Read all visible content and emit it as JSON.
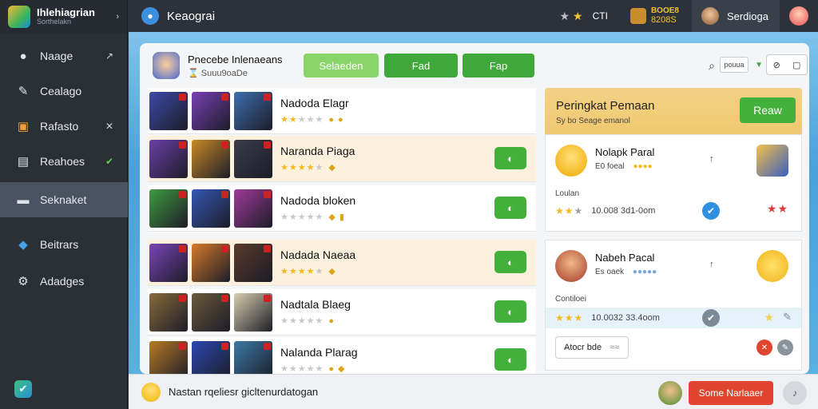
{
  "app": {
    "name": "Ihlehiagrian",
    "subtitle": "Sorthelakn",
    "chevron": "›",
    "bottom_icon": "shield-check-icon"
  },
  "sidebar": {
    "items": [
      {
        "label": "Naage",
        "icon": "pin-icon",
        "glyph": "●",
        "mark": "↗",
        "mark_green": false,
        "active": false
      },
      {
        "label": "Cealago",
        "icon": "wrench-icon",
        "glyph": "✎",
        "mark": "",
        "mark_green": false,
        "active": false
      },
      {
        "label": "Rafasto",
        "icon": "card-icon",
        "glyph": "▣",
        "mark": "✕",
        "mark_green": false,
        "active": false
      },
      {
        "label": "Reahoes",
        "icon": "list-icon",
        "glyph": "▤",
        "mark": "✔",
        "mark_green": true,
        "active": false
      },
      {
        "label": "Seknaket",
        "icon": "folder-icon",
        "glyph": "▬",
        "mark": "",
        "mark_green": false,
        "active": true
      },
      {
        "label": "Beitrars",
        "icon": "people-icon",
        "glyph": "◆",
        "mark": "",
        "mark_green": false,
        "active": false
      },
      {
        "label": "Adadges",
        "icon": "gear-icon",
        "glyph": "⚙",
        "mark": "",
        "mark_green": false,
        "active": false
      }
    ]
  },
  "topbar": {
    "title": "Keaograi",
    "app_icon": "app-icon",
    "level_label": "CTI",
    "coins_top": "BOOE8",
    "coins_bottom": "8208S",
    "user_name": "Serdioga"
  },
  "panel": {
    "title": "Pnecebe Inlenaeans",
    "subtitle": "Suuu9oaDe",
    "subtitle_prefix": "⌛",
    "tabs": [
      "Selaeden",
      "Fad",
      "Fap"
    ],
    "select_value": "pouua",
    "ctrl_left": "⊘",
    "ctrl_right": "▢"
  },
  "list": {
    "rows": [
      {
        "name": "Nadoda Elagr",
        "rating": 2,
        "extra": "● ●",
        "has_button": false,
        "alt": false,
        "tiles": [
          "#3a4aa8",
          "#7a3fb5",
          "#3d6fb0"
        ]
      },
      {
        "name": "Naranda Piaga",
        "rating": 4,
        "extra": "◆",
        "has_button": true,
        "alt": true,
        "tiles": [
          "#6a3fa8",
          "#c98a26",
          "#3b3b4a"
        ]
      },
      {
        "name": "Nadoda bloken",
        "rating": 0,
        "extra": "◆ ▮",
        "has_button": true,
        "alt": false,
        "tiles": [
          "#3f9a3f",
          "#3457b5",
          "#a03a9a"
        ]
      },
      {
        "name": "Nadada Naeaa",
        "rating": 4,
        "extra": "◆",
        "has_button": true,
        "alt": true,
        "tiles": [
          "#7a44b8",
          "#d67a2a",
          "#5a3a2a"
        ]
      },
      {
        "name": "Nadtala Blaeg",
        "rating": 0,
        "extra": "●",
        "has_button": true,
        "alt": false,
        "tiles": [
          "#8a6a3a",
          "#6a5a3a",
          "#d8cfae"
        ]
      },
      {
        "name": "Nalanda Plarag",
        "rating": 0,
        "extra": "● ◆",
        "has_button": true,
        "alt": false,
        "tiles": [
          "#b87a24",
          "#2a48b0",
          "#3a7aa8"
        ]
      }
    ],
    "button_glyph": "◐"
  },
  "leaderboard": {
    "title": "Peringkat Pemaan",
    "subtitle": "Sy bo Seage emanol",
    "button": "Reaw",
    "cards": [
      {
        "name": "Nolapk Paral",
        "meta": "E0 foeal",
        "dots": "●●●●",
        "pin": "↑",
        "label": "Loulan",
        "stars_on": 2,
        "stat": "10.008  3d1-0om",
        "red_stars": "★★"
      },
      {
        "name": "Nabeh Pacal",
        "meta": "Es oaek",
        "dots": "●●●●●",
        "pin": "↑",
        "label": "Contiloei",
        "stars_on": 3,
        "stat": "10.0032  33.4oom",
        "input_text": "Atocr bde",
        "input_suffix": "≈≈"
      }
    ]
  },
  "bottombar": {
    "text": "Nastan rqeliesr gicltenurdatogan",
    "button": "Some Narlaaer",
    "icon": "bell-icon"
  },
  "colors": {
    "accent_green": "#43b03c",
    "light_green": "#89d468",
    "danger": "#e0452f",
    "gold": "#f5b920"
  }
}
